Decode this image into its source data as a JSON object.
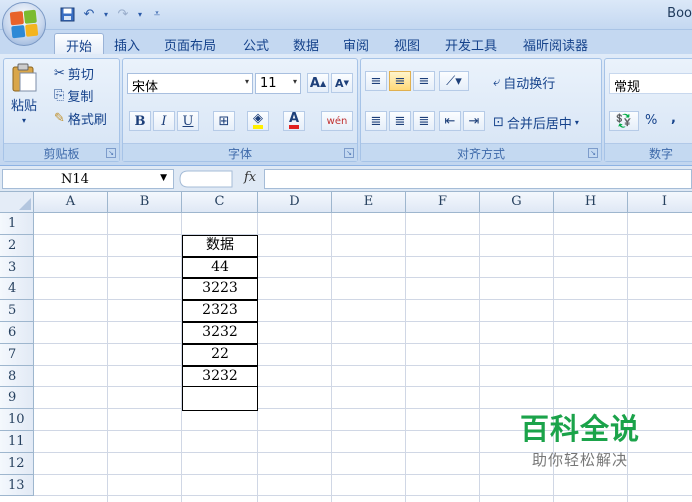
{
  "window": {
    "title": "Boo"
  },
  "qat": {
    "icons": [
      "save-icon",
      "undo-icon",
      "redo-icon",
      "customize-icon"
    ]
  },
  "tabs": [
    {
      "label": "开始",
      "active": true
    },
    {
      "label": "插入"
    },
    {
      "label": "页面布局"
    },
    {
      "label": "公式"
    },
    {
      "label": "数据"
    },
    {
      "label": "审阅"
    },
    {
      "label": "视图"
    },
    {
      "label": "开发工具"
    },
    {
      "label": "福昕阅读器"
    }
  ],
  "ribbon": {
    "clipboard": {
      "label": "剪贴板",
      "paste": "粘贴",
      "cut": "剪切",
      "copy": "复制",
      "format_painter": "格式刷"
    },
    "font": {
      "label": "字体",
      "font_name": "宋体",
      "font_size": "11",
      "bold": "B",
      "italic": "I",
      "underline": "U",
      "wen": "wén",
      "font_color_letter": "A"
    },
    "alignment": {
      "label": "对齐方式",
      "wrap_text": "自动换行",
      "merge_center": "合并后居中"
    },
    "number": {
      "label": "数字",
      "format": "常规",
      "percent": "%",
      "comma": ","
    },
    "colors": {
      "accent": "#15428b",
      "ribbon_bg": "#cadcf2",
      "highlight": "#ffd978",
      "font_red": "#e02020",
      "fill_yellow": "#ffef00"
    }
  },
  "formula_bar": {
    "name_box": "N14",
    "fx": "fx",
    "formula": ""
  },
  "sheet": {
    "columns": [
      "A",
      "B",
      "C",
      "D",
      "E",
      "F",
      "G",
      "H",
      "I"
    ],
    "rows": [
      "1",
      "2",
      "3",
      "4",
      "5",
      "6",
      "7",
      "8",
      "9",
      "10",
      "11",
      "12",
      "13"
    ],
    "c_column": {
      "header": "数据",
      "values": [
        "44",
        "3223",
        "2323",
        "3232",
        "22",
        "3232"
      ]
    }
  },
  "watermark": {
    "title": "百科全说",
    "subtitle": "助你轻松解决"
  }
}
